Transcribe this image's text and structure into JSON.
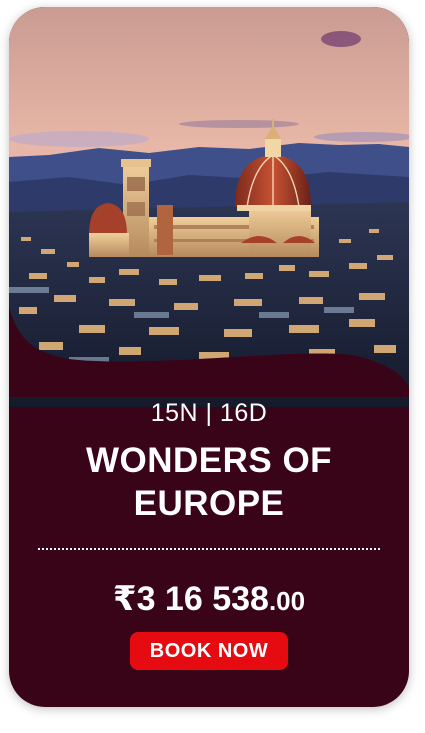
{
  "package": {
    "duration": "15N | 16D",
    "title": "WONDERS OF EUROPE",
    "price_currency": "₹",
    "price_main": "3 16 538",
    "price_decimal": ".00",
    "cta_label": "BOOK NOW"
  },
  "colors": {
    "card_background": "#3a0418",
    "cta_background": "#e60b10",
    "text": "#ffffff"
  },
  "image": {
    "subject": "florence-skyline-cathedral-dome-at-dusk"
  }
}
